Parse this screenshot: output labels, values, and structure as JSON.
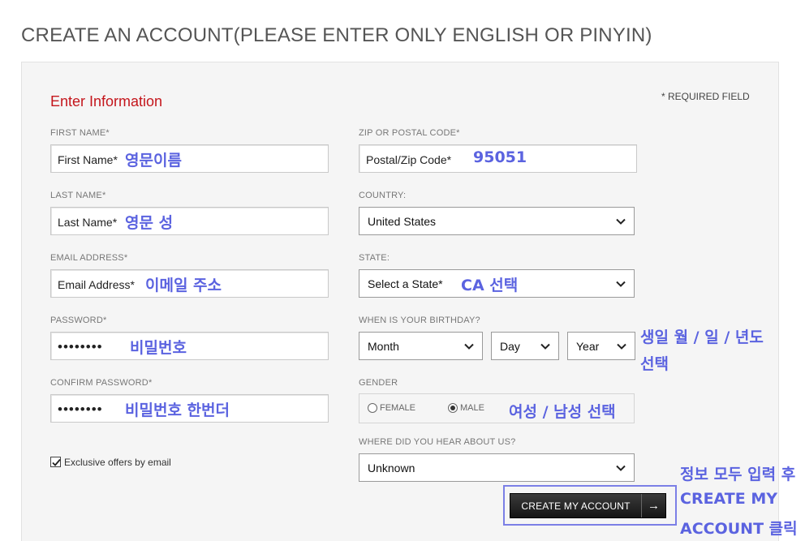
{
  "page": {
    "title": "CREATE AN ACCOUNT(PLEASE ENTER ONLY ENGLISH OR PINYIN)"
  },
  "form": {
    "section_title": "Enter Information",
    "required_note": "* REQUIRED FIELD",
    "first_name": {
      "label": "FIRST NAME*",
      "placeholder": "First Name*"
    },
    "last_name": {
      "label": "LAST NAME*",
      "placeholder": "Last Name*"
    },
    "email": {
      "label": "EMAIL ADDRESS*",
      "placeholder": "Email Address*"
    },
    "password": {
      "label": "PASSWORD*",
      "value": "••••••••"
    },
    "confirm_password": {
      "label": "CONFIRM PASSWORD*",
      "value": "••••••••"
    },
    "zip": {
      "label": "ZIP OR POSTAL CODE*",
      "placeholder": "Postal/Zip Code*"
    },
    "country": {
      "label": "COUNTRY:",
      "selected": "United States"
    },
    "state": {
      "label": "STATE:",
      "selected": "Select a State*"
    },
    "birthday": {
      "label": "WHEN IS YOUR BIRTHDAY?",
      "month": "Month",
      "day": "Day",
      "year": "Year"
    },
    "gender": {
      "label": "GENDER",
      "options": [
        "FEMALE",
        "MALE"
      ],
      "selected": "MALE"
    },
    "hear_about": {
      "label": "WHERE DID YOU HEAR ABOUT US?",
      "selected": "Unknown"
    },
    "offers": {
      "label": "Exclusive offers by email",
      "checked": true
    },
    "submit": {
      "label": "CREATE MY ACCOUNT",
      "arrow": "→"
    }
  },
  "annotations": {
    "first_name": "영문이름",
    "last_name": "영문 성",
    "email": "이메일 주소",
    "password": "비밀번호",
    "confirm_password": "비밀번호 한번더",
    "zip": "95051",
    "state": "CA 선택",
    "birthday_line1": "생일 월 / 일 / 년도",
    "birthday_line2": "선택",
    "gender": "여성 / 남성 선택",
    "submit_line1": "정보 모두 입력 후",
    "submit_line2": "CREATE MY",
    "submit_line3": "ACCOUNT 클릭"
  },
  "colors": {
    "accent_red": "#c4161c",
    "annotation_blue": "#5b63e0",
    "button_dark": "#1f1f1f"
  }
}
